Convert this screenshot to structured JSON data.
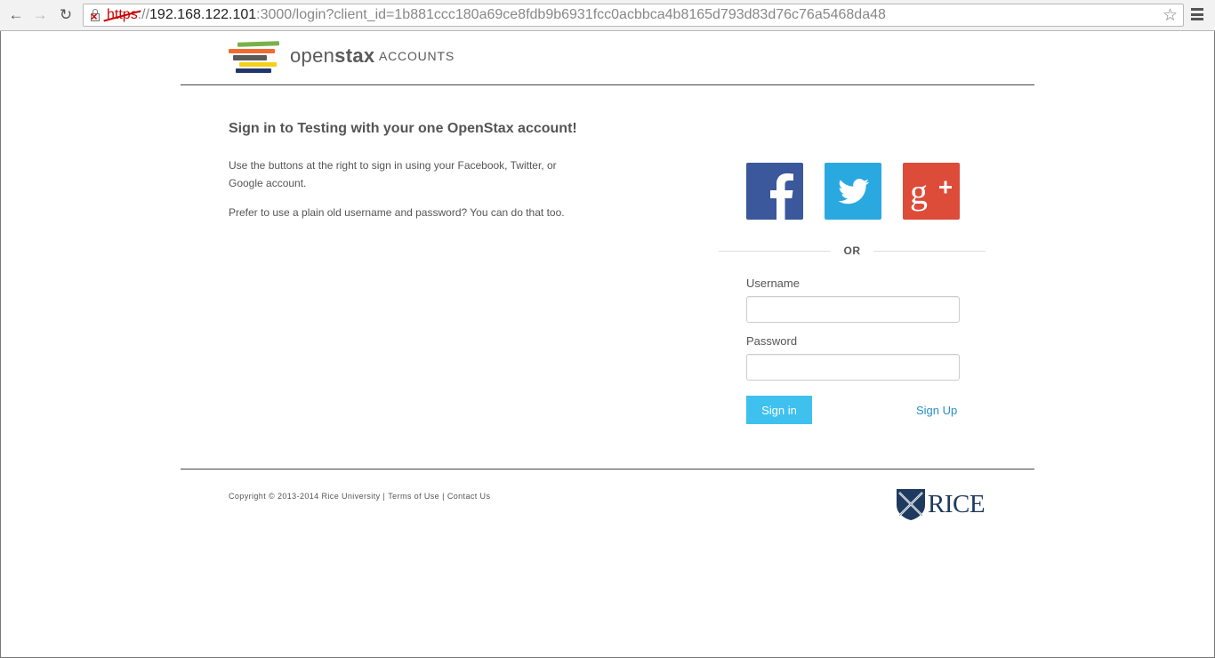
{
  "browser": {
    "url_scheme": "https",
    "url_sep": "://",
    "url_host": "192.168.122.101",
    "url_rest": ":3000/login?client_id=1b881ccc180a69ce8fdb9b6931fcc0acbbca4b8165d793d83d76c76a5468da48"
  },
  "header": {
    "brand_light": "open",
    "brand_bold": "stax",
    "brand_sub": "ACCOUNTS",
    "logo_colors": [
      "#78b04a",
      "#f36b32",
      "#5a5a5a",
      "#f5d019",
      "#21366b"
    ]
  },
  "intro": {
    "headline": "Sign in to Testing with your one OpenStax account!",
    "para1": "Use the buttons at the right to sign in using your Facebook, Twitter, or Google account.",
    "para2": "Prefer to use a plain old username and password? You can do that too."
  },
  "social": {
    "facebook_color": "#3a589b",
    "twitter_color": "#2aa9e0",
    "google_color": "#dd4b39"
  },
  "form": {
    "or_label": "OR",
    "username_label": "Username",
    "username_value": "",
    "password_label": "Password",
    "password_value": "",
    "signin_label": "Sign in",
    "signup_label": "Sign Up",
    "accent": "#3fc1ef"
  },
  "footer": {
    "copyright": "Copyright © 2013-2014 Rice University",
    "terms": "Terms of Use",
    "contact": "Contact Us",
    "sep": "|",
    "rice_label": "RICE"
  }
}
